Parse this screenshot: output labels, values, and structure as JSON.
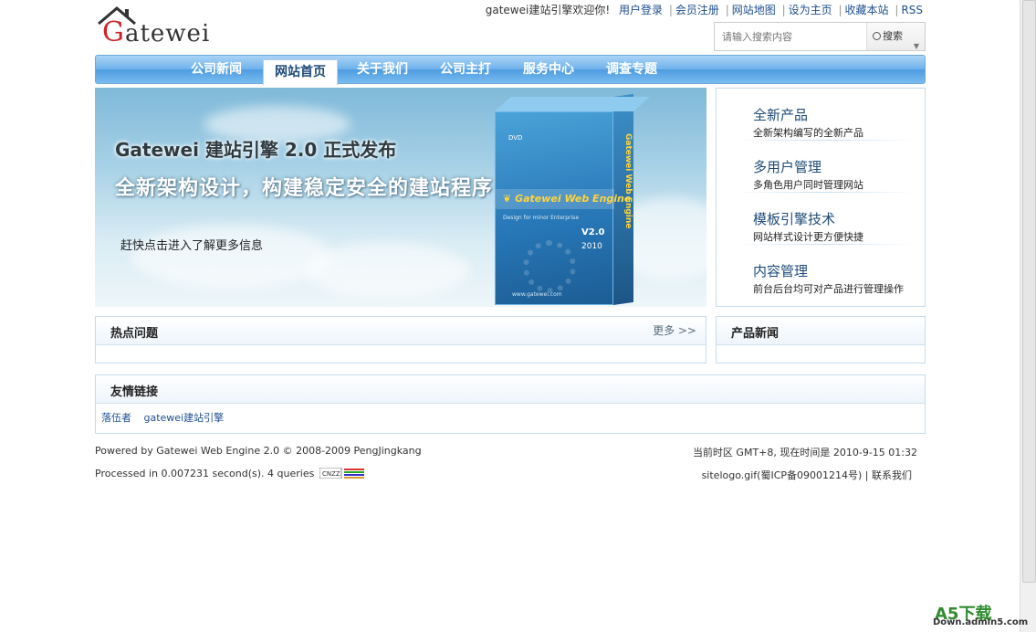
{
  "header": {
    "logo_text": "Gatewei",
    "welcome": "gatewei建站引擎欢迎你!",
    "links": [
      "用户登录",
      "会员注册",
      "网站地图",
      "设为主页",
      "收藏本站",
      "RSS"
    ],
    "search_placeholder": "请输入搜索内容",
    "search_button": "搜索"
  },
  "nav": {
    "items": [
      "公司新闻",
      "网站首页",
      "关于我们",
      "公司主打",
      "服务中心",
      "调查专题"
    ],
    "active": "网站首页"
  },
  "banner": {
    "headline": "Gatewei 建站引擎 2.0 正式发布",
    "subheadline": "全新架构设计，构建稳定安全的建站程序",
    "cta": "赶快点击进入了解更多信息",
    "box": {
      "disc": "DVD",
      "product": "Gatewei Web Engine",
      "tagline": "Design for minor Enterprise",
      "version": "V2.0",
      "year": "2010",
      "url": "www.gatewei.com"
    }
  },
  "features": [
    {
      "title": "全新产品",
      "desc": "全新架构编写的全新产品"
    },
    {
      "title": "多用户管理",
      "desc": "多角色用户同时管理网站"
    },
    {
      "title": "模板引擎技术",
      "desc": "网站样式设计更方便快捷"
    },
    {
      "title": "内容管理",
      "desc": "前台后台均可对产品进行管理操作"
    }
  ],
  "hot": {
    "title": "热点问题",
    "more": "更多 >>"
  },
  "product_news": {
    "title": "产品新闻"
  },
  "friend_links": {
    "title": "友情链接",
    "items": [
      "落伍者",
      "gatewei建站引擎"
    ]
  },
  "footer": {
    "powered": "Powered by Gatewei Web Engine 2.0 © 2008-2009 PengJingkang",
    "time": "当前时区 GMT+8, 现在时间是 2010-9-15 01:32",
    "processed": "Processed in 0.007231 second(s). 4 queries",
    "cnzz": "CNZZ",
    "icp": "sitelogo.gif(蜀ICP备09001214号) | 联系我们"
  },
  "watermark": {
    "big": "A5下载",
    "small": "Down.admin5.com"
  },
  "colors": {
    "nav_blue": "#6db1ea",
    "link": "#1f4f8f",
    "brand_red": "#c8262a",
    "yellow": "#ffd53a"
  }
}
